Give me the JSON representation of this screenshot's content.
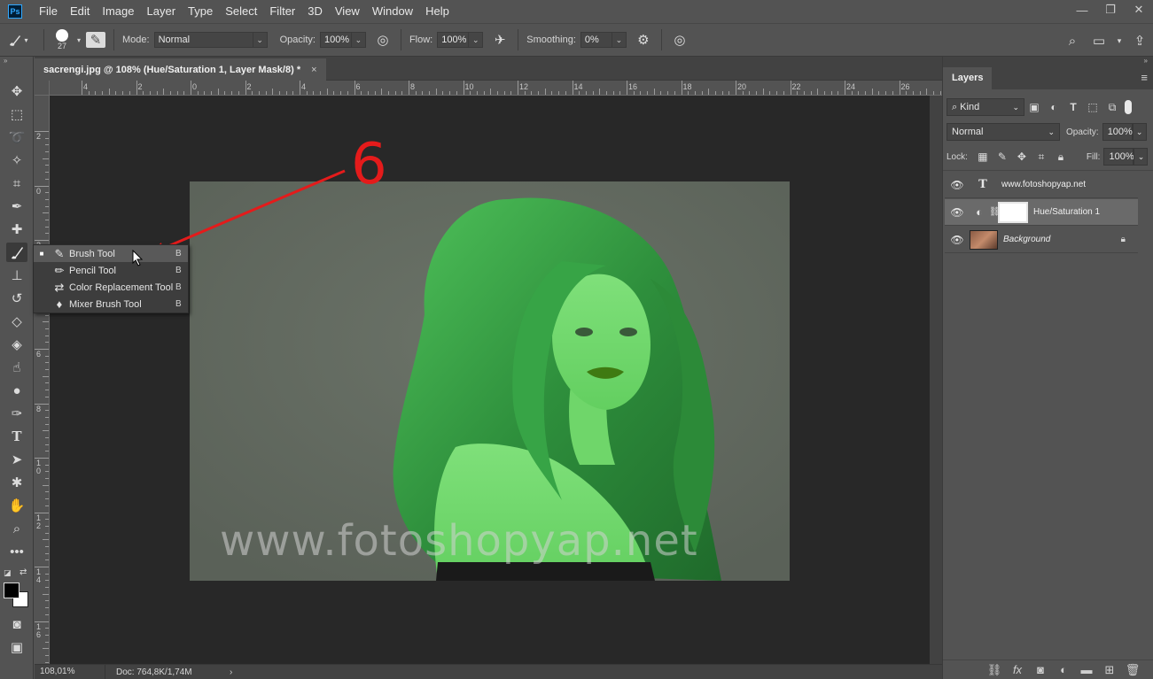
{
  "app": {
    "logo": "Ps"
  },
  "menu": [
    "File",
    "Edit",
    "Image",
    "Layer",
    "Type",
    "Select",
    "Filter",
    "3D",
    "View",
    "Window",
    "Help"
  ],
  "window_controls": {
    "minimize": "—",
    "restore": "❐",
    "close": "✕"
  },
  "options": {
    "brush_size": "27",
    "mode_label": "Mode:",
    "mode_value": "Normal",
    "opacity_label": "Opacity:",
    "opacity_value": "100%",
    "flow_label": "Flow:",
    "flow_value": "100%",
    "smoothing_label": "Smoothing:",
    "smoothing_value": "0%"
  },
  "document": {
    "tab_title": "sacrengi.jpg @ 108% (Hue/Saturation 1, Layer Mask/8) *",
    "close": "×",
    "watermark": "www.fotoshopyap.net",
    "annotation_number": "6"
  },
  "ruler": {
    "h_labels": [
      "4",
      "2",
      "0",
      "2",
      "4",
      "6",
      "8",
      "10",
      "12",
      "14",
      "16",
      "18",
      "20",
      "22",
      "24",
      "26"
    ],
    "v_labels": [
      "2",
      "0",
      "2",
      "4",
      "6",
      "8",
      "1 0",
      "1 2",
      "1 4",
      "1 6"
    ]
  },
  "flyout": [
    {
      "label": "Brush Tool",
      "key": "B",
      "icon": "brush-icon",
      "selected": true
    },
    {
      "label": "Pencil Tool",
      "key": "B",
      "icon": "pencil-icon",
      "selected": false
    },
    {
      "label": "Color Replacement Tool",
      "key": "B",
      "icon": "color-replacement-icon",
      "selected": false
    },
    {
      "label": "Mixer Brush Tool",
      "key": "B",
      "icon": "mixer-brush-icon",
      "selected": false
    }
  ],
  "status": {
    "zoom": "108,01%",
    "doc": "Doc: 764,8K/1,74M",
    "arrow": "›"
  },
  "layers_panel": {
    "tab": "Layers",
    "kind_label": "Kind",
    "blend_mode": "Normal",
    "opacity_label": "Opacity:",
    "opacity_value": "100%",
    "lock_label": "Lock:",
    "fill_label": "Fill:",
    "fill_value": "100%",
    "layers": [
      {
        "name": "www.fotoshopyap.net",
        "type": "text",
        "selected": false
      },
      {
        "name": "Hue/Saturation 1",
        "type": "adjustment",
        "selected": true
      },
      {
        "name": "Background",
        "type": "image",
        "selected": false
      }
    ]
  },
  "colors": {
    "accent_red": "#e41b1b",
    "tint_green": "#3fa84a",
    "bg": "#535353"
  }
}
